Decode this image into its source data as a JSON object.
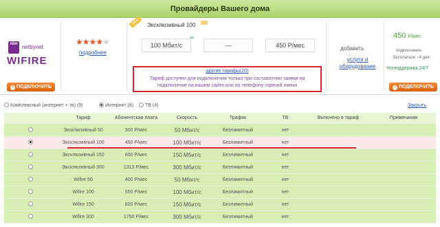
{
  "header": {
    "title": "Провайдеры Вашего дома"
  },
  "provider": {
    "logo_small": "netbynet",
    "logo_big": "WIFIRE",
    "logo_badge": "nbn",
    "connect_label": "ПОДКЛЮЧИТЬ",
    "rating": 4,
    "rating_max": 5,
    "more_link": "подробнее"
  },
  "featured_tariff": {
    "sticker": "NEW",
    "name": "Эксклюзивный 100",
    "infinity": "∞",
    "speed": "100 Мбит/с",
    "tv": "—",
    "price": "450 Р/мес",
    "other_tariffs_link": "другие тарифы(20)",
    "note": "Тариф доступен для подключения только при составлении заявки на подключение на нашем сайте или по телефону горячей линии"
  },
  "services": {
    "add_label": "добавить",
    "add_link": "услуги и оборудование"
  },
  "pricing": {
    "price": "450",
    "unit": "Р/мес",
    "connection_label": "подключение",
    "connection_value": "бесплатное   ~4 дня",
    "support": "техподдержка 24/7",
    "connect_label": "ПОДКЛЮЧИТЬ"
  },
  "filters": {
    "tabs": [
      {
        "label": "Комплексный (интернет + тв) (9)",
        "selected": false
      },
      {
        "label": "Интернет (8)",
        "selected": true
      },
      {
        "label": "ТВ (4)",
        "selected": false
      }
    ],
    "close_label": "Закрыть"
  },
  "table": {
    "columns": [
      "",
      "Тариф",
      "Абонентская плата",
      "Скорость",
      "Трафик",
      "ТВ",
      "Включено в тариф",
      "Примечания"
    ],
    "rows": [
      {
        "name": "Эксклюзивный 50",
        "price": "300 Р/мес",
        "speed": "50 Мбит/с",
        "traffic": "Безлимитный",
        "tv": "нет",
        "selected": false
      },
      {
        "name": "Эксклюзивный 100",
        "price": "450 Р/мес",
        "speed": "100 Мбит/с",
        "traffic": "Безлимитный",
        "tv": "нет",
        "selected": true
      },
      {
        "name": "Эксклюзивный 150",
        "price": "600 Р/мес",
        "speed": "150 Мбит/с",
        "traffic": "Безлимитный",
        "tv": "нет",
        "selected": false
      },
      {
        "name": "Эксклюзивный 300",
        "price": "1313 Р/мес",
        "speed": "300 Мбит/с",
        "traffic": "Безлимитный",
        "tv": "нет",
        "selected": false
      },
      {
        "name": "Wifire 50",
        "price": "400 Р/мес",
        "speed": "50 Мбит/с",
        "traffic": "Безлимитный",
        "tv": "нет",
        "selected": false
      },
      {
        "name": "Wifire 100",
        "price": "550 Р/мес",
        "speed": "100 Мбит/с",
        "traffic": "Безлимитный",
        "tv": "нет",
        "selected": false
      },
      {
        "name": "Wifire 150",
        "price": "820 Р/мес",
        "speed": "150 Мбит/с",
        "traffic": "Безлимитный",
        "tv": "нет",
        "selected": false
      },
      {
        "name": "Wifire 300",
        "price": "1750 Р/мес",
        "speed": "300 Мбит/с",
        "traffic": "Безлимитный",
        "tv": "нет",
        "selected": false
      }
    ]
  }
}
